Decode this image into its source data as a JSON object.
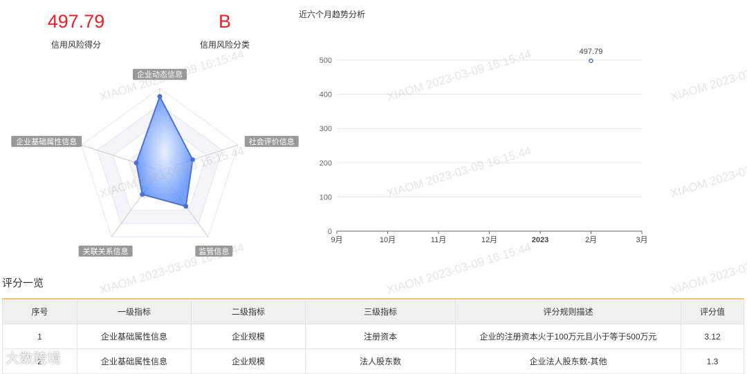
{
  "kpis": [
    {
      "value": "497.79",
      "label": "信用风险得分"
    },
    {
      "value": "B",
      "label": "信用风险分类"
    }
  ],
  "radar": {
    "indicators": [
      "企业动态信息",
      "社会评价信息",
      "监管信息",
      "关联关系信息",
      "企业基础属性信息"
    ],
    "values": [
      0.9,
      0.42,
      0.54,
      0.36,
      0.3
    ],
    "max": 1,
    "color": "#4f6fd6"
  },
  "chart_data": {
    "type": "line",
    "title": "近六个月趋势分析",
    "categories": [
      "9月",
      "10月",
      "11月",
      "12月",
      "2023",
      "2月",
      "3月"
    ],
    "values": [
      null,
      null,
      null,
      null,
      null,
      497.79,
      null
    ],
    "ylim": [
      0,
      500
    ],
    "yticks": [
      0,
      100,
      200,
      300,
      400,
      500
    ],
    "data_label": "497.79",
    "color": "#5470c6"
  },
  "section_title": "评分一览",
  "table": {
    "headers": [
      "序号",
      "一级指标",
      "二级指标",
      "三级指标",
      "评分规则描述",
      "评分值"
    ],
    "rows": [
      [
        "1",
        "企业基础属性信息",
        "企业规模",
        "注册资本",
        "企业的注册资本火于100万元且小于等于500万元",
        "3.12"
      ],
      [
        "2",
        "企业基础属性信息",
        "企业规模",
        "法人股东数",
        "企业法人股东数-其他",
        "1.3"
      ]
    ]
  },
  "watermark": "XIAOM 2023-03-09 16:15:44",
  "logo": "大数跨境"
}
